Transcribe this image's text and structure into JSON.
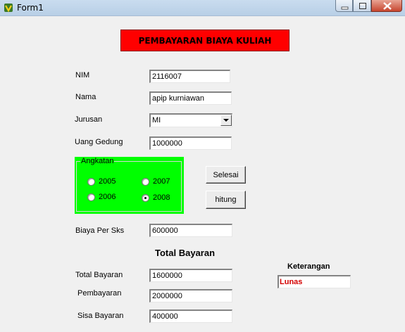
{
  "window": {
    "title": "Form1",
    "icons": {
      "app": "vb-app-icon",
      "minimize": "minimize-icon",
      "maximize": "maximize-icon",
      "close": "close-icon"
    }
  },
  "header": {
    "banner": "PEMBAYARAN BIAYA KULIAH",
    "banner_color": "#ff0000"
  },
  "form": {
    "nim_label": "NIM",
    "nim_value": "2116007",
    "nama_label": "Nama",
    "nama_value": "apip kurniawan",
    "jurusan_label": "Jurusan",
    "jurusan_value": "MI",
    "uang_gedung_label": "Uang Gedung",
    "uang_gedung_value": "1000000",
    "biaya_sks_label": "Biaya Per Sks",
    "biaya_sks_value": "600000"
  },
  "angkatan": {
    "title": "Angkatan",
    "group_color": "#00ff00",
    "options": [
      {
        "label": "2005",
        "checked": false
      },
      {
        "label": "2007",
        "checked": false
      },
      {
        "label": "2006",
        "checked": false
      },
      {
        "label": "2008",
        "checked": true
      }
    ]
  },
  "buttons": {
    "selesai": "Selesai",
    "hitung": "hitung"
  },
  "total": {
    "section_title": "Total Bayaran",
    "total_label": "Total Bayaran",
    "total_value": "1600000",
    "pembayaran_label": "Pembayaran",
    "pembayaran_value": "2000000",
    "sisa_label": "Sisa Bayaran",
    "sisa_value": "400000"
  },
  "keterangan": {
    "title": "Keterangan",
    "value": "Lunas",
    "value_color": "#d40000"
  }
}
